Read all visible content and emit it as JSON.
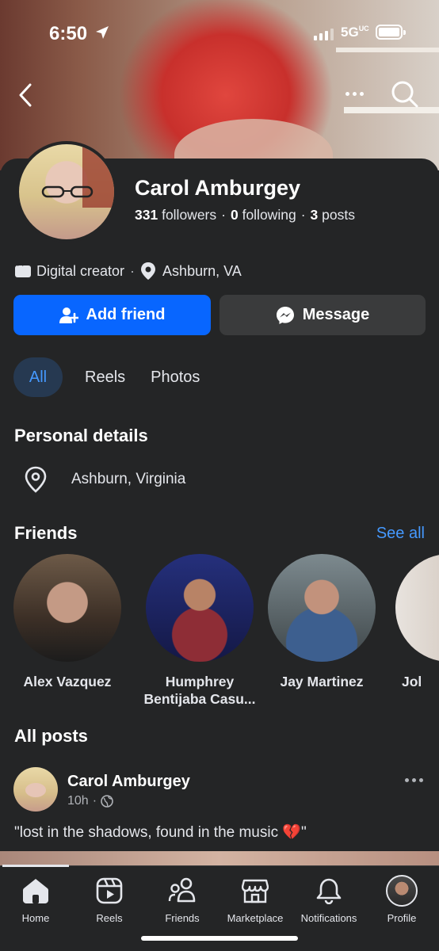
{
  "status_bar": {
    "time": "6:50",
    "network": "5G",
    "network_suffix": "UC"
  },
  "profile": {
    "name": "Carol Amburgey",
    "followers_count": "331",
    "followers_label": "followers",
    "following_count": "0",
    "following_label": "following",
    "posts_count": "3",
    "posts_label": "posts",
    "category": "Digital creator",
    "location": "Ashburn, VA"
  },
  "actions": {
    "add_friend": "Add friend",
    "message": "Message"
  },
  "tabs": [
    {
      "label": "All",
      "active": true
    },
    {
      "label": "Reels",
      "active": false
    },
    {
      "label": "Photos",
      "active": false
    }
  ],
  "personal_details": {
    "title": "Personal details",
    "location": "Ashburn, Virginia"
  },
  "friends": {
    "title": "Friends",
    "see_all": "See all",
    "items": [
      {
        "name": "Alex Vazquez"
      },
      {
        "name": "Humphrey Bentijaba Casu..."
      },
      {
        "name": "Jay Martinez"
      },
      {
        "name": "Jol"
      }
    ]
  },
  "all_posts": {
    "title": "All posts",
    "post": {
      "author": "Carol Amburgey",
      "time": "10h",
      "text": "\"lost in the shadows, found in the music 💔\""
    }
  },
  "bottom_nav": [
    {
      "label": "Home",
      "icon": "home-icon",
      "active": true
    },
    {
      "label": "Reels",
      "icon": "reels-icon"
    },
    {
      "label": "Friends",
      "icon": "friends-icon"
    },
    {
      "label": "Marketplace",
      "icon": "marketplace-icon"
    },
    {
      "label": "Notifications",
      "icon": "bell-icon"
    },
    {
      "label": "Profile",
      "icon": "profile-avatar"
    }
  ],
  "colors": {
    "accent": "#0866ff",
    "link": "#4599ff",
    "background": "#242526",
    "secondary_button": "#3a3b3c"
  }
}
